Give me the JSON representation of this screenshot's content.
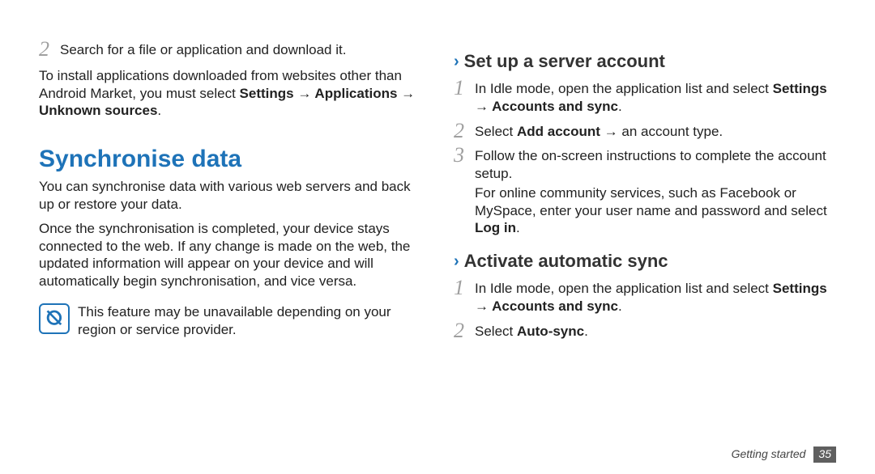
{
  "left": {
    "step2": {
      "num": "2",
      "text": "Search for a file or application and download it."
    },
    "install_para_a": "To install applications downloaded from websites other than Android Market, you must select ",
    "install_bold": "Settings → Applications → Unknown sources",
    "install_para_b": ".",
    "h1": "Synchronise data",
    "sync_p1": "You can synchronise data with various web servers and back up or restore your data.",
    "sync_p2": "Once the synchronisation is completed, your device stays connected to the web. If any change is made on the web, the updated information will appear on your device and will automatically begin synchronisation, and vice versa.",
    "note": "This feature may be unavailable depending on your region or service provider."
  },
  "right": {
    "h2a": "Set up a server account",
    "s1": {
      "num": "1",
      "a": "In Idle mode, open the application list and select ",
      "bold": "Settings → Accounts and sync",
      "b": "."
    },
    "s2": {
      "num": "2",
      "a": "Select ",
      "bold": "Add account",
      "b": " → an account type."
    },
    "s3": {
      "num": "3",
      "a": "Follow the on-screen instructions to complete the account setup.",
      "p2a": "For online community services, such as Facebook or MySpace, enter your user name and password and select ",
      "p2bold": "Log in",
      "p2b": "."
    },
    "h2b": "Activate automatic sync",
    "t1": {
      "num": "1",
      "a": "In Idle mode, open the application list and select ",
      "bold": "Settings → Accounts and sync",
      "b": "."
    },
    "t2": {
      "num": "2",
      "a": "Select ",
      "bold": "Auto-sync",
      "b": "."
    }
  },
  "footer": {
    "section": "Getting started",
    "page": "35"
  }
}
